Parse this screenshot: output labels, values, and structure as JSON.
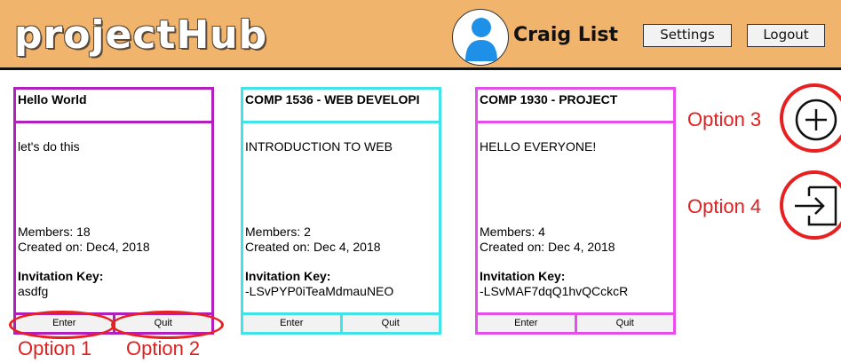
{
  "header": {
    "logo": "projectHub",
    "username": "Craig List",
    "settings_label": "Settings",
    "logout_label": "Logout",
    "avatar_icon": "user-avatar-icon"
  },
  "cards": [
    {
      "title": "Hello World",
      "description": "let's do this",
      "members": "Members: 18",
      "created": "Created on: Dec4, 2018",
      "invitation_label": "Invitation Key:",
      "invitation_key": "asdfg",
      "enter_label": "Enter",
      "quit_label": "Quit",
      "color": "#b11fbe"
    },
    {
      "title": "COMP 1536 - WEB DEVELOPI",
      "description": "INTRODUCTION TO WEB",
      "members": "Members: 2",
      "created": "Created on: Dec 4, 2018",
      "invitation_label": "Invitation Key:",
      "invitation_key": "-LSvPYP0iTeaMdmauNEO",
      "enter_label": "Enter",
      "quit_label": "Quit",
      "color": "#3fe3e8"
    },
    {
      "title": "COMP 1930 - PROJECT",
      "description": "HELLO EVERYONE!",
      "members": "Members: 4",
      "created": "Created on: Dec 4, 2018",
      "invitation_label": "Invitation Key:",
      "invitation_key": "-LSvMAF7dqQ1hvQCckcR",
      "enter_label": "Enter",
      "quit_label": "Quit",
      "color": "#e54ee8"
    }
  ],
  "actions": {
    "add_icon": "plus-circle-icon",
    "join_icon": "enter-icon"
  },
  "annotations": {
    "option1": "Option 1",
    "option2": "Option 2",
    "option3": "Option 3",
    "option4": "Option 4",
    "color": "#e02020"
  }
}
